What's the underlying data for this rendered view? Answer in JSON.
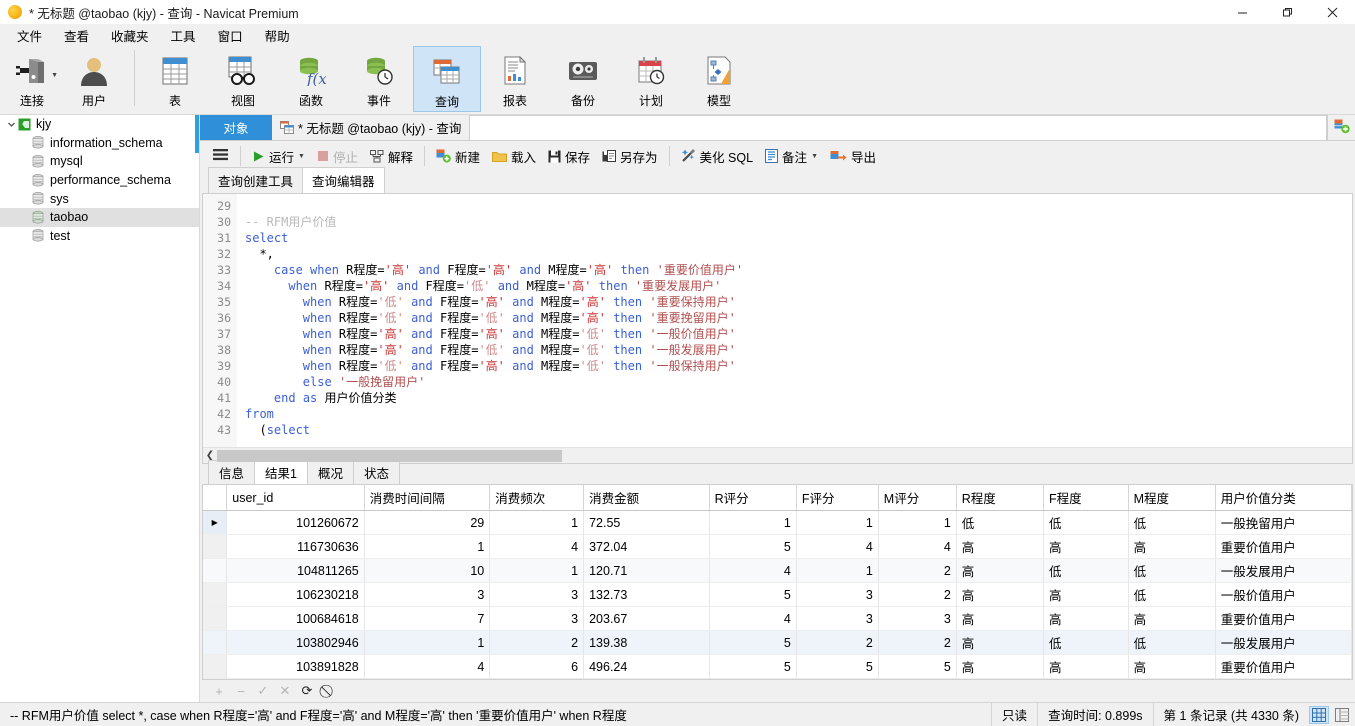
{
  "window": {
    "title": "* 无标题 @taobao (kjy) - 查询 - Navicat Premium",
    "app_icon": "navicat-dolphin-icon",
    "minimize": "—",
    "maximize": "❐",
    "close": "✕"
  },
  "menubar": {
    "items": [
      {
        "label": "文件",
        "name": "menu-file"
      },
      {
        "label": "查看",
        "name": "menu-view"
      },
      {
        "label": "收藏夹",
        "name": "menu-favorites"
      },
      {
        "label": "工具",
        "name": "menu-tools"
      },
      {
        "label": "窗口",
        "name": "menu-window"
      },
      {
        "label": "帮助",
        "name": "menu-help"
      }
    ]
  },
  "toolbar": {
    "items": [
      {
        "label": "连接",
        "icon": "connection-icon",
        "selected": false,
        "has_caret": true
      },
      {
        "label": "用户",
        "icon": "user-icon",
        "selected": false,
        "has_caret": false
      },
      {
        "label": "表",
        "icon": "table-icon",
        "selected": false,
        "has_caret": false
      },
      {
        "label": "视图",
        "icon": "view-icon",
        "selected": false,
        "has_caret": false
      },
      {
        "label": "函数",
        "icon": "function-icon",
        "selected": false,
        "has_caret": false
      },
      {
        "label": "事件",
        "icon": "event-icon",
        "selected": false,
        "has_caret": false
      },
      {
        "label": "查询",
        "icon": "query-icon",
        "selected": true,
        "has_caret": false
      },
      {
        "label": "报表",
        "icon": "report-icon",
        "selected": false,
        "has_caret": false
      },
      {
        "label": "备份",
        "icon": "backup-icon",
        "selected": false,
        "has_caret": false
      },
      {
        "label": "计划",
        "icon": "schedule-icon",
        "selected": false,
        "has_caret": false
      },
      {
        "label": "模型",
        "icon": "model-icon",
        "selected": false,
        "has_caret": false
      }
    ]
  },
  "sidebar": {
    "connection": {
      "label": "kjy",
      "icon": "mysql-connection-icon",
      "expanded": true
    },
    "databases": [
      {
        "label": "information_schema",
        "selected": false
      },
      {
        "label": "mysql",
        "selected": false
      },
      {
        "label": "performance_schema",
        "selected": false
      },
      {
        "label": "sys",
        "selected": false
      },
      {
        "label": "taobao",
        "selected": true
      },
      {
        "label": "test",
        "selected": false
      }
    ]
  },
  "tabstrip": {
    "object_tab": "对象",
    "query_tab": "* 无标题 @taobao (kjy) - 查询",
    "query_tab_icon": "query-tab-icon",
    "new_tab_icon": "new-query-icon"
  },
  "query_toolbar": {
    "menu_icon": "hamburger-icon",
    "buttons": [
      {
        "label": "运行",
        "icon": "play-icon",
        "disabled": false,
        "has_caret": true
      },
      {
        "label": "停止",
        "icon": "stop-icon",
        "disabled": true,
        "has_caret": false
      },
      {
        "label": "解释",
        "icon": "explain-icon",
        "disabled": false,
        "has_caret": false
      },
      {
        "label": "新建",
        "icon": "new-icon",
        "disabled": false,
        "has_caret": false
      },
      {
        "label": "载入",
        "icon": "load-folder-icon",
        "disabled": false,
        "has_caret": false
      },
      {
        "label": "保存",
        "icon": "save-icon",
        "disabled": false,
        "has_caret": false
      },
      {
        "label": "另存为",
        "icon": "save-as-icon",
        "disabled": false,
        "has_caret": false
      },
      {
        "label": "美化 SQL",
        "icon": "beautify-sql-icon",
        "disabled": false,
        "has_caret": false
      },
      {
        "label": "备注",
        "icon": "comment-icon",
        "disabled": false,
        "has_caret": true
      },
      {
        "label": "导出",
        "icon": "export-icon",
        "disabled": false,
        "has_caret": false
      }
    ]
  },
  "editor_tabs": [
    {
      "label": "查询创建工具",
      "active": false
    },
    {
      "label": "查询编辑器",
      "active": true
    }
  ],
  "editor": {
    "first_line_number": 29,
    "line_numbers": [
      29,
      30,
      31,
      32,
      33,
      34,
      35,
      36,
      37,
      38,
      39,
      40,
      41,
      42,
      43
    ],
    "lines": [
      {
        "n": 29,
        "tokens": []
      },
      {
        "n": 30,
        "tokens": [
          {
            "t": "-- RFM用户价值",
            "c": "cmt"
          }
        ]
      },
      {
        "n": 31,
        "tokens": [
          {
            "t": "select",
            "c": "kw"
          }
        ]
      },
      {
        "n": 32,
        "tokens": [
          {
            "t": "  *,",
            "c": "plain"
          }
        ]
      },
      {
        "n": 33,
        "tokens": [
          {
            "t": "    ",
            "c": "plain"
          },
          {
            "t": "case",
            "c": "kw"
          },
          {
            "t": " ",
            "c": "plain"
          },
          {
            "t": "when",
            "c": "kw"
          },
          {
            "t": " R程度=",
            "c": "plain"
          },
          {
            "t": "'高'",
            "c": "str-hi"
          },
          {
            "t": " ",
            "c": "plain"
          },
          {
            "t": "and",
            "c": "kw"
          },
          {
            "t": " F程度=",
            "c": "plain"
          },
          {
            "t": "'高'",
            "c": "str-hi"
          },
          {
            "t": " ",
            "c": "plain"
          },
          {
            "t": "and",
            "c": "kw"
          },
          {
            "t": " M程度=",
            "c": "plain"
          },
          {
            "t": "'高'",
            "c": "str-hi"
          },
          {
            "t": " ",
            "c": "plain"
          },
          {
            "t": "then",
            "c": "kw"
          },
          {
            "t": " ",
            "c": "plain"
          },
          {
            "t": "'重要价值用户'",
            "c": "str"
          }
        ]
      },
      {
        "n": 34,
        "tokens": [
          {
            "t": "      ",
            "c": "plain"
          },
          {
            "t": "when",
            "c": "kw"
          },
          {
            "t": " R程度=",
            "c": "plain"
          },
          {
            "t": "'高'",
            "c": "str-hi"
          },
          {
            "t": " ",
            "c": "plain"
          },
          {
            "t": "and",
            "c": "kw"
          },
          {
            "t": " F程度=",
            "c": "plain"
          },
          {
            "t": "'低'",
            "c": "str-lo"
          },
          {
            "t": " ",
            "c": "plain"
          },
          {
            "t": "and",
            "c": "kw"
          },
          {
            "t": " M程度=",
            "c": "plain"
          },
          {
            "t": "'高'",
            "c": "str-hi"
          },
          {
            "t": " ",
            "c": "plain"
          },
          {
            "t": "then",
            "c": "kw"
          },
          {
            "t": " ",
            "c": "plain"
          },
          {
            "t": "'重要发展用户'",
            "c": "str"
          }
        ]
      },
      {
        "n": 35,
        "tokens": [
          {
            "t": "        ",
            "c": "plain"
          },
          {
            "t": "when",
            "c": "kw"
          },
          {
            "t": " R程度=",
            "c": "plain"
          },
          {
            "t": "'低'",
            "c": "str-lo"
          },
          {
            "t": " ",
            "c": "plain"
          },
          {
            "t": "and",
            "c": "kw"
          },
          {
            "t": " F程度=",
            "c": "plain"
          },
          {
            "t": "'高'",
            "c": "str-hi"
          },
          {
            "t": " ",
            "c": "plain"
          },
          {
            "t": "and",
            "c": "kw"
          },
          {
            "t": " M程度=",
            "c": "plain"
          },
          {
            "t": "'高'",
            "c": "str-hi"
          },
          {
            "t": " ",
            "c": "plain"
          },
          {
            "t": "then",
            "c": "kw"
          },
          {
            "t": " ",
            "c": "plain"
          },
          {
            "t": "'重要保持用户'",
            "c": "str"
          }
        ]
      },
      {
        "n": 36,
        "tokens": [
          {
            "t": "        ",
            "c": "plain"
          },
          {
            "t": "when",
            "c": "kw"
          },
          {
            "t": " R程度=",
            "c": "plain"
          },
          {
            "t": "'低'",
            "c": "str-lo"
          },
          {
            "t": " ",
            "c": "plain"
          },
          {
            "t": "and",
            "c": "kw"
          },
          {
            "t": " F程度=",
            "c": "plain"
          },
          {
            "t": "'低'",
            "c": "str-lo"
          },
          {
            "t": " ",
            "c": "plain"
          },
          {
            "t": "and",
            "c": "kw"
          },
          {
            "t": " M程度=",
            "c": "plain"
          },
          {
            "t": "'高'",
            "c": "str-hi"
          },
          {
            "t": " ",
            "c": "plain"
          },
          {
            "t": "then",
            "c": "kw"
          },
          {
            "t": " ",
            "c": "plain"
          },
          {
            "t": "'重要挽留用户'",
            "c": "str"
          }
        ]
      },
      {
        "n": 37,
        "tokens": [
          {
            "t": "        ",
            "c": "plain"
          },
          {
            "t": "when",
            "c": "kw"
          },
          {
            "t": " R程度=",
            "c": "plain"
          },
          {
            "t": "'高'",
            "c": "str-hi"
          },
          {
            "t": " ",
            "c": "plain"
          },
          {
            "t": "and",
            "c": "kw"
          },
          {
            "t": " F程度=",
            "c": "plain"
          },
          {
            "t": "'高'",
            "c": "str-hi"
          },
          {
            "t": " ",
            "c": "plain"
          },
          {
            "t": "and",
            "c": "kw"
          },
          {
            "t": " M程度=",
            "c": "plain"
          },
          {
            "t": "'低'",
            "c": "str-lo"
          },
          {
            "t": " ",
            "c": "plain"
          },
          {
            "t": "then",
            "c": "kw"
          },
          {
            "t": " ",
            "c": "plain"
          },
          {
            "t": "'一般价值用户'",
            "c": "str"
          }
        ]
      },
      {
        "n": 38,
        "tokens": [
          {
            "t": "        ",
            "c": "plain"
          },
          {
            "t": "when",
            "c": "kw"
          },
          {
            "t": " R程度=",
            "c": "plain"
          },
          {
            "t": "'高'",
            "c": "str-hi"
          },
          {
            "t": " ",
            "c": "plain"
          },
          {
            "t": "and",
            "c": "kw"
          },
          {
            "t": " F程度=",
            "c": "plain"
          },
          {
            "t": "'低'",
            "c": "str-lo"
          },
          {
            "t": " ",
            "c": "plain"
          },
          {
            "t": "and",
            "c": "kw"
          },
          {
            "t": " M程度=",
            "c": "plain"
          },
          {
            "t": "'低'",
            "c": "str-lo"
          },
          {
            "t": " ",
            "c": "plain"
          },
          {
            "t": "then",
            "c": "kw"
          },
          {
            "t": " ",
            "c": "plain"
          },
          {
            "t": "'一般发展用户'",
            "c": "str"
          }
        ]
      },
      {
        "n": 39,
        "tokens": [
          {
            "t": "        ",
            "c": "plain"
          },
          {
            "t": "when",
            "c": "kw"
          },
          {
            "t": " R程度=",
            "c": "plain"
          },
          {
            "t": "'低'",
            "c": "str-lo"
          },
          {
            "t": " ",
            "c": "plain"
          },
          {
            "t": "and",
            "c": "kw"
          },
          {
            "t": " F程度=",
            "c": "plain"
          },
          {
            "t": "'高'",
            "c": "str-hi"
          },
          {
            "t": " ",
            "c": "plain"
          },
          {
            "t": "and",
            "c": "kw"
          },
          {
            "t": " M程度=",
            "c": "plain"
          },
          {
            "t": "'低'",
            "c": "str-lo"
          },
          {
            "t": " ",
            "c": "plain"
          },
          {
            "t": "then",
            "c": "kw"
          },
          {
            "t": " ",
            "c": "plain"
          },
          {
            "t": "'一般保持用户'",
            "c": "str"
          }
        ]
      },
      {
        "n": 40,
        "tokens": [
          {
            "t": "        ",
            "c": "plain"
          },
          {
            "t": "else",
            "c": "kw"
          },
          {
            "t": " ",
            "c": "plain"
          },
          {
            "t": "'一般挽留用户'",
            "c": "str"
          }
        ]
      },
      {
        "n": 41,
        "tokens": [
          {
            "t": "    ",
            "c": "plain"
          },
          {
            "t": "end",
            "c": "kw"
          },
          {
            "t": " ",
            "c": "plain"
          },
          {
            "t": "as",
            "c": "kw"
          },
          {
            "t": " 用户价值分类",
            "c": "plain"
          }
        ]
      },
      {
        "n": 42,
        "tokens": [
          {
            "t": "from",
            "c": "kw"
          }
        ]
      },
      {
        "n": 43,
        "tokens": [
          {
            "t": "  (",
            "c": "plain"
          },
          {
            "t": "select",
            "c": "kw"
          }
        ]
      }
    ]
  },
  "result_tabs": [
    {
      "label": "信息",
      "active": false
    },
    {
      "label": "结果1",
      "active": true
    },
    {
      "label": "概况",
      "active": false
    },
    {
      "label": "状态",
      "active": false
    }
  ],
  "grid": {
    "columns": [
      {
        "label": "user_id",
        "align": "right",
        "width": 104
      },
      {
        "label": "消费时间间隔",
        "align": "right",
        "width": 95
      },
      {
        "label": "消费频次",
        "align": "right",
        "width": 71
      },
      {
        "label": "消费金额",
        "align": "left",
        "width": 95
      },
      {
        "label": "R评分",
        "align": "right",
        "width": 66
      },
      {
        "label": "F评分",
        "align": "right",
        "width": 62
      },
      {
        "label": "M评分",
        "align": "right",
        "width": 59
      },
      {
        "label": "R程度",
        "align": "left",
        "width": 66
      },
      {
        "label": "F程度",
        "align": "left",
        "width": 64
      },
      {
        "label": "M程度",
        "align": "left",
        "width": 66
      },
      {
        "label": "用户价值分类",
        "align": "left",
        "width": 103
      }
    ],
    "rows": [
      {
        "current": true,
        "cells": [
          "101260672",
          "29",
          "1",
          "72.55",
          "1",
          "1",
          "1",
          "低",
          "低",
          "低",
          "一般挽留用户"
        ]
      },
      {
        "current": false,
        "cells": [
          "116730636",
          "1",
          "4",
          "372.04",
          "5",
          "4",
          "4",
          "高",
          "高",
          "高",
          "重要价值用户"
        ]
      },
      {
        "current": false,
        "cells": [
          "104811265",
          "10",
          "1",
          "120.71",
          "4",
          "1",
          "2",
          "高",
          "低",
          "低",
          "一般发展用户"
        ]
      },
      {
        "current": false,
        "cells": [
          "106230218",
          "3",
          "3",
          "132.73",
          "5",
          "3",
          "2",
          "高",
          "高",
          "低",
          "一般价值用户"
        ]
      },
      {
        "current": false,
        "cells": [
          "100684618",
          "7",
          "3",
          "203.67",
          "4",
          "3",
          "3",
          "高",
          "高",
          "高",
          "重要价值用户"
        ]
      },
      {
        "current": false,
        "cells": [
          "103802946",
          "1",
          "2",
          "139.38",
          "5",
          "2",
          "2",
          "高",
          "低",
          "低",
          "一般发展用户"
        ]
      },
      {
        "current": false,
        "cells": [
          "103891828",
          "4",
          "6",
          "496.24",
          "5",
          "5",
          "5",
          "高",
          "高",
          "高",
          "重要价值用户"
        ]
      }
    ]
  },
  "grid_toolbar": {
    "buttons": [
      {
        "icon": "add-record-icon",
        "label": "+",
        "enabled": false
      },
      {
        "icon": "remove-record-icon",
        "label": "−",
        "enabled": false
      },
      {
        "icon": "apply-change-icon",
        "label": "✓",
        "enabled": false
      },
      {
        "icon": "cancel-change-icon",
        "label": "✕",
        "enabled": false
      },
      {
        "icon": "refresh-icon",
        "label": "⟳",
        "enabled": true
      },
      {
        "icon": "stop-loading-icon",
        "label": "⃠",
        "enabled": true
      }
    ]
  },
  "statusbar": {
    "sql_preview": "-- RFM用户价值 select            *,     case when R程度='高' and F程度='高' and M程度='高' then '重要价值用户'            when R程度",
    "readonly": "只读",
    "query_time": "查询时间: 0.899s",
    "record_info": "第 1 条记录 (共 4330 条)",
    "view_grid_icon": "grid-view-icon",
    "view_form_icon": "form-view-icon"
  },
  "colors": {
    "accent_blue": "#2f8fd8",
    "selected_toolbar": "#cfe4f7",
    "keyword": "#3b5fd4",
    "string_high": "#cc3333",
    "string_low": "#d08a8a",
    "comment": "#b9b9b9"
  }
}
